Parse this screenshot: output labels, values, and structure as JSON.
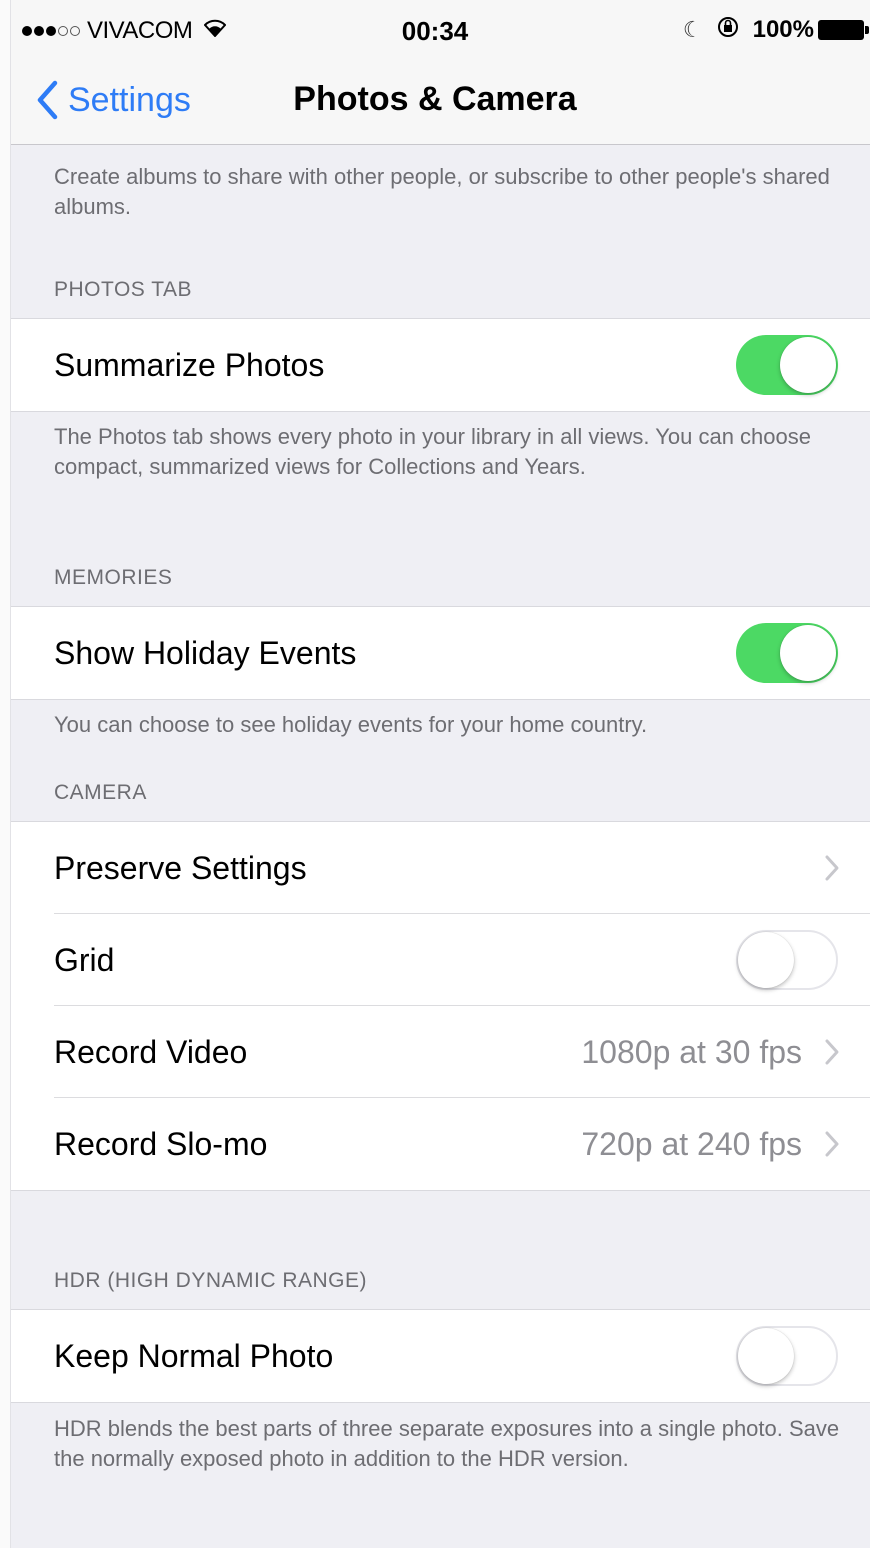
{
  "status_bar": {
    "carrier": "VIVACOM",
    "time": "00:34",
    "battery": "100%"
  },
  "nav": {
    "back_label": "Settings",
    "title": "Photos & Camera"
  },
  "shared_footer": "Create albums to share with other people, or subscribe to other people's shared albums.",
  "photos_tab": {
    "header": "PHOTOS TAB",
    "summarize_label": "Summarize Photos",
    "summarize_on": true,
    "footer": "The Photos tab shows every photo in your library in all views. You can choose compact, summarized views for Collections and Years."
  },
  "memories": {
    "header": "MEMORIES",
    "holiday_label": "Show Holiday Events",
    "holiday_on": true,
    "footer": "You can choose to see holiday events for your home country."
  },
  "camera": {
    "header": "CAMERA",
    "preserve_label": "Preserve Settings",
    "grid_label": "Grid",
    "grid_on": false,
    "record_video_label": "Record Video",
    "record_video_value": "1080p at 30 fps",
    "record_slomo_label": "Record Slo-mo",
    "record_slomo_value": "720p at 240 fps"
  },
  "hdr": {
    "header": "HDR (HIGH DYNAMIC RANGE)",
    "keep_normal_label": "Keep Normal Photo",
    "keep_normal_on": false,
    "footer": "HDR blends the best parts of three separate exposures into a single photo. Save the normally exposed photo in addition to the HDR version."
  },
  "colors": {
    "accent": "#2e7cf6",
    "toggle_on": "#4cd964",
    "background": "#efeff4"
  }
}
